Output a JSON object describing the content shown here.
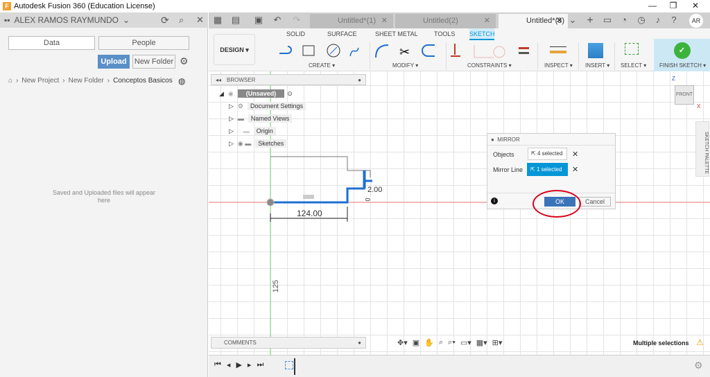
{
  "window": {
    "title": "Autodesk Fusion 360 (Education License)",
    "logo": "F",
    "controls": [
      "minimize-icon",
      "restore-icon",
      "close-icon"
    ]
  },
  "data_panel": {
    "user": "ALEX RAMOS RAYMUNDO",
    "tabs": [
      "Data",
      "People"
    ],
    "upload": "Upload",
    "new_folder": "New Folder",
    "breadcrumb": [
      "New Project",
      "New Folder",
      "Conceptos Basicos"
    ],
    "empty_text": "Saved and Uploaded files will appear here"
  },
  "doc_tabs": [
    {
      "label": "Untitled*(1)",
      "active": false
    },
    {
      "label": "Untitled(2)",
      "active": false
    },
    {
      "label": "Untitled*(3)",
      "active": true
    }
  ],
  "user_initials": "AR",
  "ribbon": {
    "workspace": "DESIGN",
    "tabs": [
      "SOLID",
      "SURFACE",
      "SHEET METAL",
      "TOOLS",
      "SKETCH"
    ],
    "active_tab": "SKETCH",
    "groups": [
      "CREATE",
      "MODIFY",
      "CONSTRAINTS",
      "INSPECT",
      "INSERT",
      "SELECT",
      "FINISH SKETCH"
    ]
  },
  "browser": {
    "title": "BROWSER",
    "root": "(Unsaved)",
    "items": [
      "Document Settings",
      "Named Views",
      "Origin",
      "Sketches"
    ]
  },
  "comments": {
    "title": "COMMENTS"
  },
  "viewcube": {
    "face": "FRONT",
    "z": "Z",
    "x": "X"
  },
  "sketch_palette": "SKETCH PALETTE",
  "sketch": {
    "dim_horizontal": "124.00",
    "dim_small": "2.00",
    "dim_vertical": "125",
    "dim_tiny": "0"
  },
  "mirror": {
    "title": "MIRROR",
    "objects_label": "Objects",
    "objects_value": "4 selected",
    "line_label": "Mirror Line",
    "line_value": "1 selected",
    "ok": "OK",
    "cancel": "Cancel"
  },
  "status": {
    "text": "Multiple selections"
  },
  "colors": {
    "accent": "#0696d7",
    "upload": "#5b8fc7",
    "ok": "#3b73b9",
    "finish": "#cde8f5",
    "highlight_circle": "#d9001b"
  }
}
